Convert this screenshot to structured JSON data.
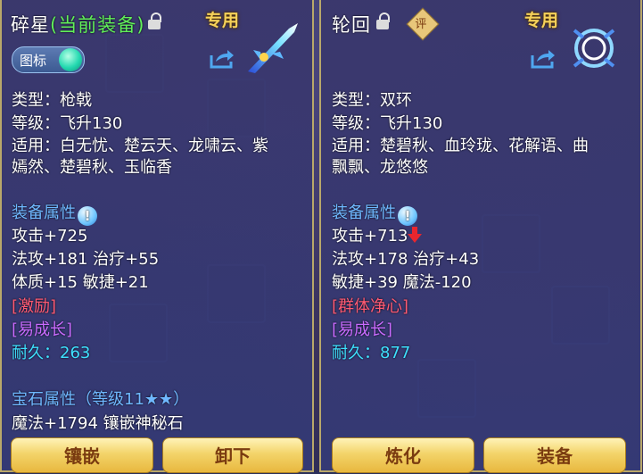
{
  "left": {
    "title": "碎星",
    "title_suffix": "(当前装备)",
    "special_tag": "专用",
    "icon_toggle_label": "图标",
    "type": "类型：枪戟",
    "level": "等级：飞升130",
    "fit_line1": "适用：白无忧、楚云天、龙啸云、紫",
    "fit_line2": "嫣然、楚碧秋、玉临香",
    "attr_title": "装备属性",
    "attack": "攻击+725",
    "magatk_heal": "法攻+181 治疗+55",
    "con_agi": "体质+15 敏捷+21",
    "effect1": "[激励]",
    "effect2": "[易成长]",
    "durability": "耐久：263",
    "gem_title": "宝石属性（等级11★★）",
    "gem_line": "魔法+1794 镶嵌神秘石",
    "btn1": "镶嵌",
    "btn2": "卸下",
    "info_glyph": "!"
  },
  "right": {
    "title": "轮回",
    "badge": "评",
    "special_tag": "专用",
    "type": "类型：双环",
    "level": "等级：飞升130",
    "fit_line1": "适用：楚碧秋、血玲珑、花解语、曲",
    "fit_line2": "飘飘、龙悠悠",
    "attr_title": "装备属性",
    "attack": "攻击+713",
    "magatk_heal": "法攻+178 治疗+43",
    "agi_mag": "敏捷+39 魔法-120",
    "effect1": "[群体净心]",
    "effect2": "[易成长]",
    "durability": "耐久：877",
    "btn1": "炼化",
    "btn2": "装备",
    "info_glyph": "!"
  },
  "colors": {
    "accent": "#f6d25a",
    "section": "#6fb8ff",
    "red": "#ff5a73",
    "purple": "#c86bff",
    "cyan": "#3fe0ff"
  }
}
